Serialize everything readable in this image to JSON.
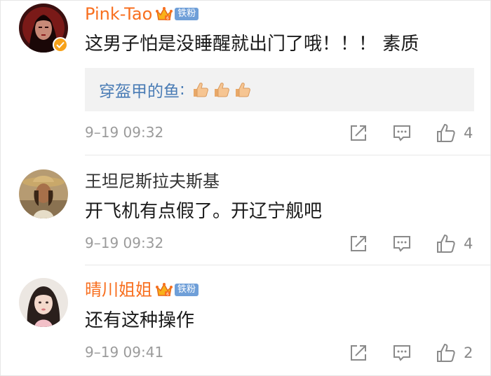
{
  "comments": [
    {
      "username": "Pink-Tao",
      "vip": true,
      "verified": true,
      "fan_badge": "铁粉",
      "text": "这男子怕是没睡醒就出门了哦！！！ 素质",
      "reply": {
        "name": "穿盔甲的鱼",
        "colon": ":",
        "emoji": [
          "thumbs-up",
          "thumbs-up",
          "thumbs-up"
        ]
      },
      "timestamp": "9–19 09:32",
      "likes": "4"
    },
    {
      "username": "王坦尼斯拉夫斯基",
      "vip": false,
      "verified": false,
      "text": "开飞机有点假了。开辽宁舰吧",
      "timestamp": "9–19 09:32",
      "likes": "4"
    },
    {
      "username": "晴川姐姐",
      "vip": true,
      "verified": false,
      "fan_badge": "铁粉",
      "text": "还有这种操作",
      "timestamp": "9–19 09:41",
      "likes": "2"
    }
  ],
  "colors": {
    "vip_name": "#f86f1f",
    "reply_name": "#4a7cb5",
    "fan_badge": "#6f9fd8",
    "meta_gray": "#9b9b9b",
    "reply_bg": "#f2f2f2"
  },
  "icons": {
    "share": "share-icon",
    "reply": "comment-icon",
    "like": "thumbs-up-icon",
    "crown": "crown-icon",
    "verified": "verified-badge-icon"
  }
}
